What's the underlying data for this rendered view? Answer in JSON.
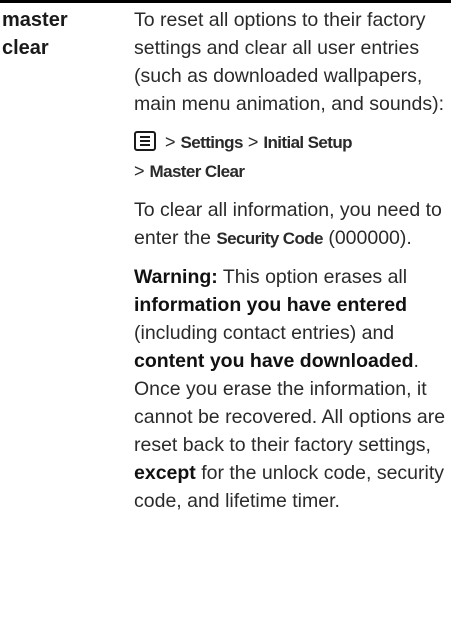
{
  "term": {
    "line1": "master",
    "line2": "clear"
  },
  "intro": "To reset all options to their factory settings and clear all user entries (such as downloaded wallpapers, main menu animation, and sounds):",
  "path": {
    "sep": ">",
    "settings": "Settings",
    "initial_setup": "Initial Setup",
    "master_clear": "Master Clear"
  },
  "clear_info": {
    "before": "To clear all information, you need to enter the ",
    "code_label": "Security Code",
    "after": " (000000)."
  },
  "warning": {
    "label": "Warning:",
    "t1": " This option erases all ",
    "b1": "information you have entered",
    "t2": " (including contact entries) and ",
    "b2": "content you have downloaded",
    "t3": ". Once you erase the information, it cannot be recovered. All options are reset back to their factory settings, ",
    "b3": "except",
    "t4": " for the unlock code, security code, and lifetime timer."
  }
}
